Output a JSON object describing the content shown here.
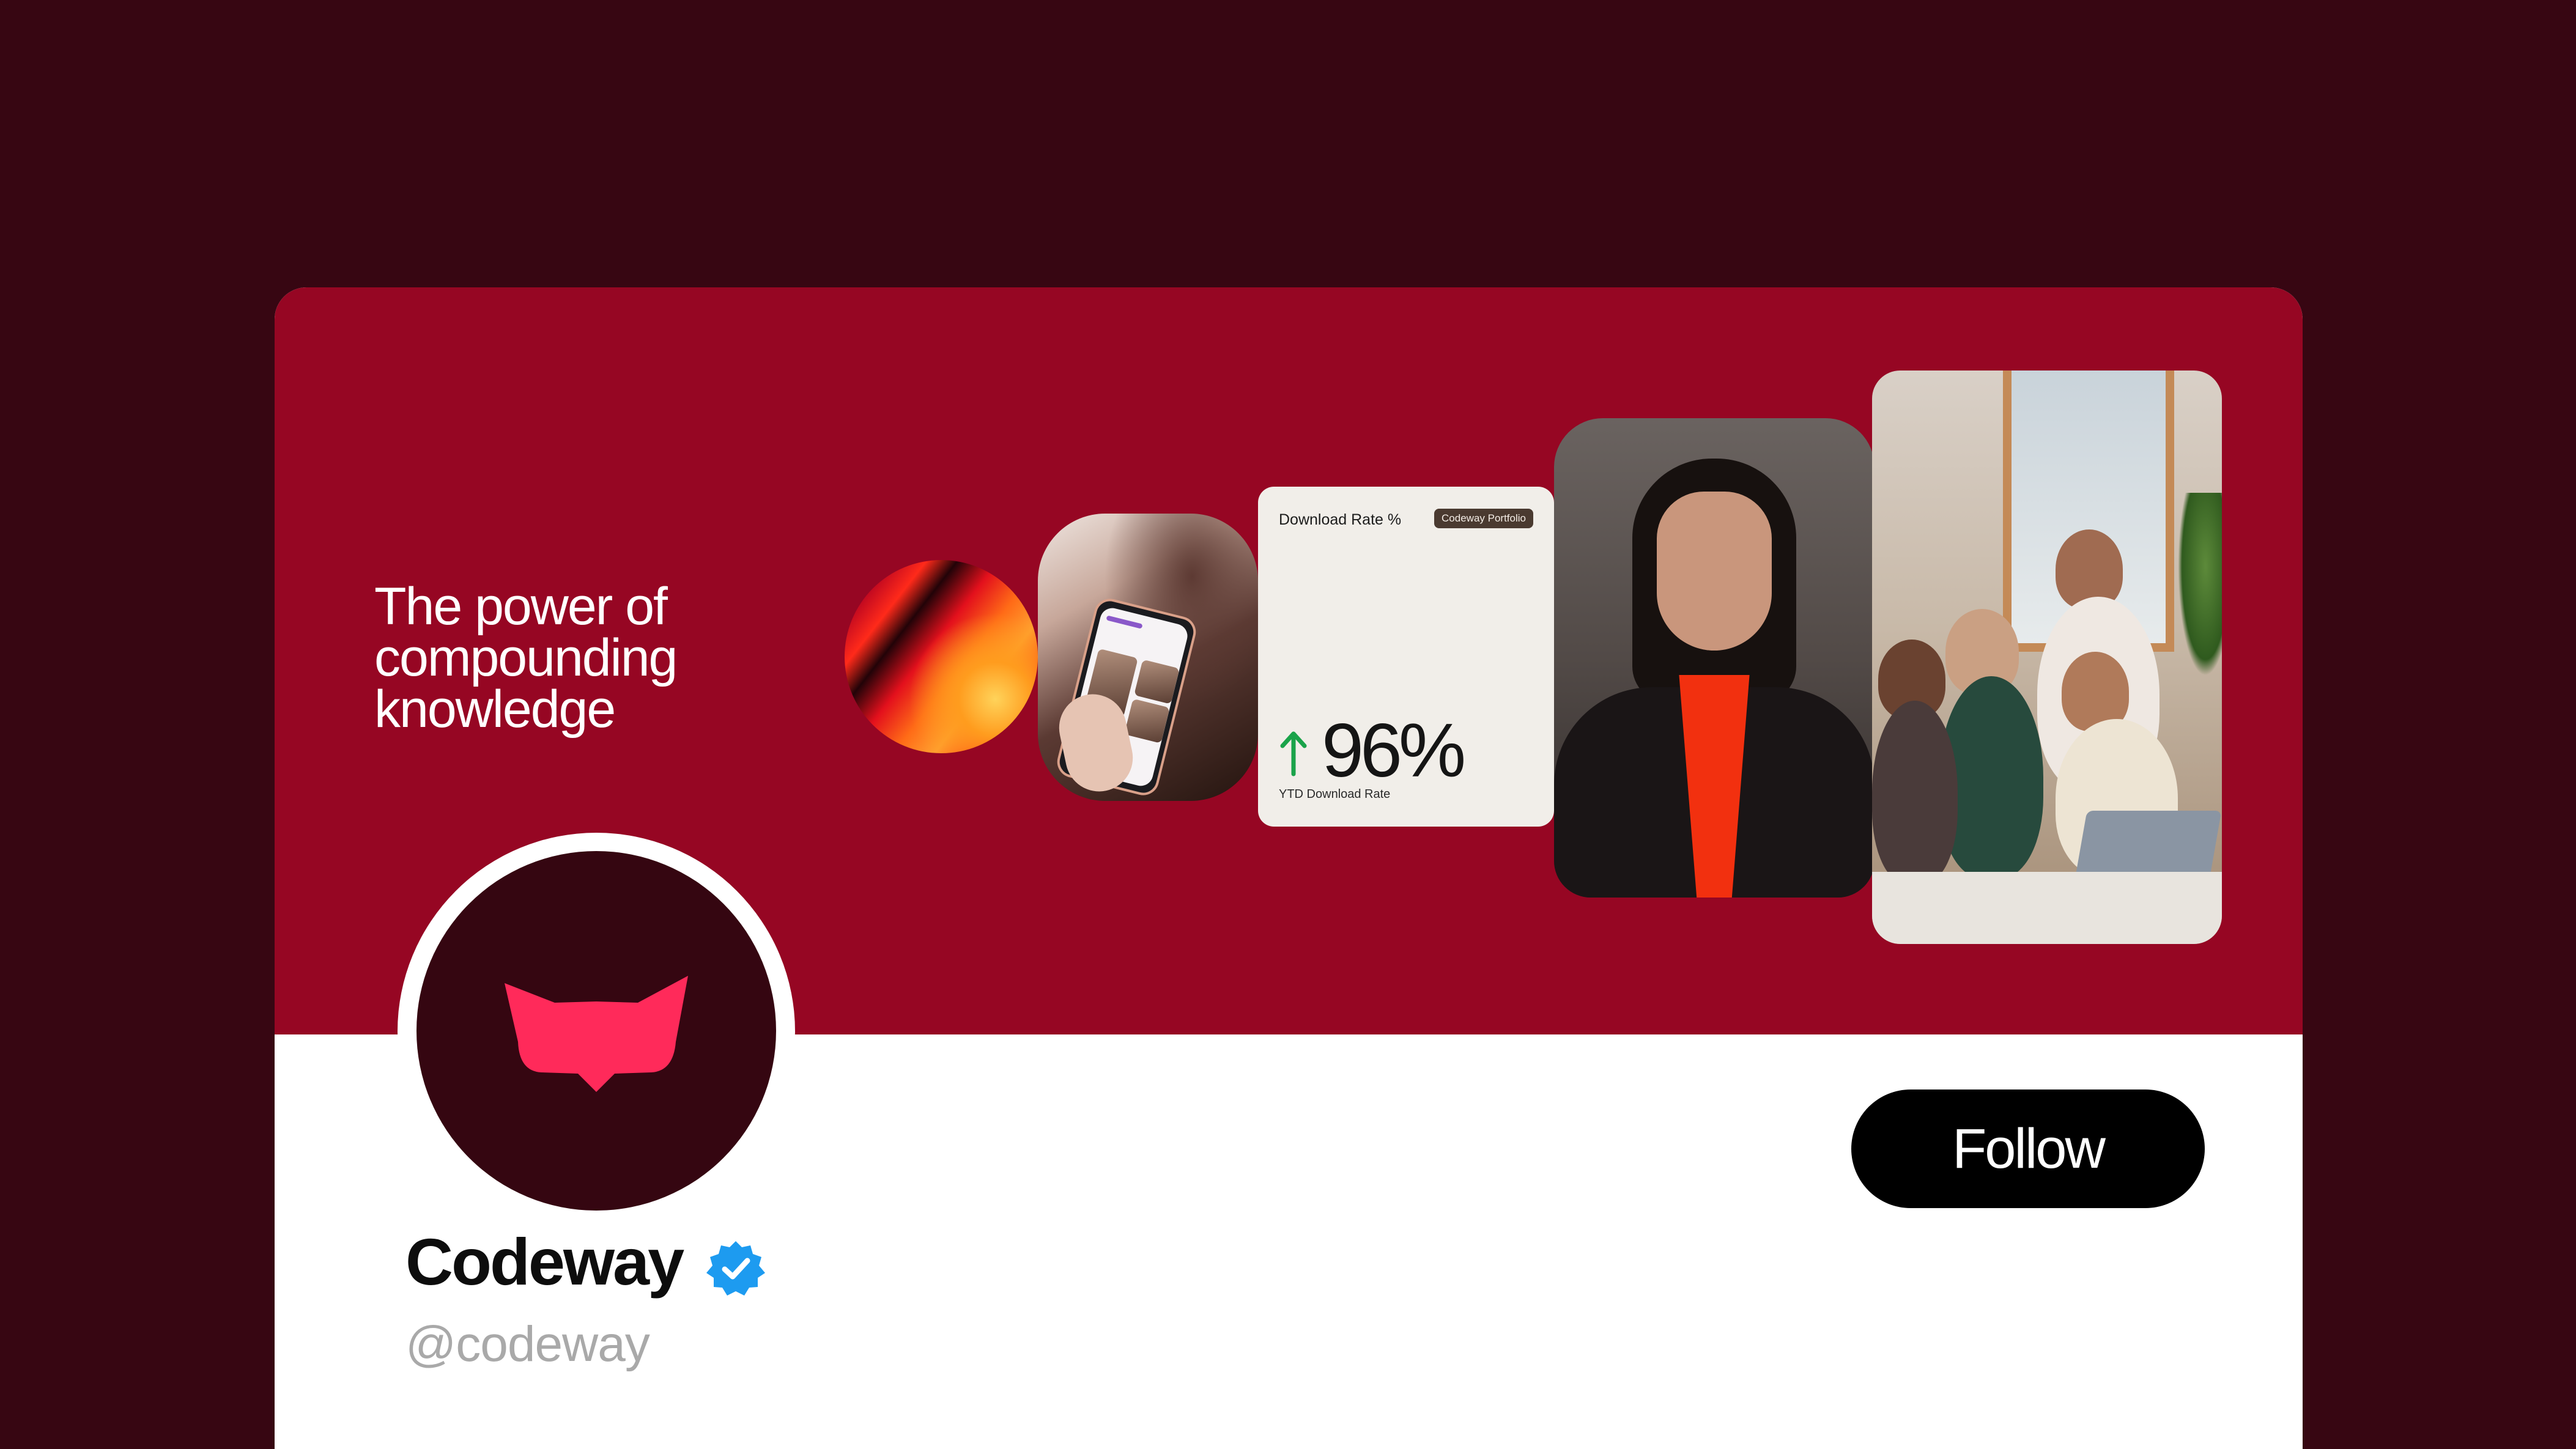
{
  "banner": {
    "tagline_lines": [
      "The power of",
      "compounding",
      "knowledge"
    ]
  },
  "stat_card": {
    "title": "Download Rate %",
    "badge": "Codeway Portfolio",
    "value": "96%",
    "subtitle": "YTD Download Rate"
  },
  "profile": {
    "name": "Codeway",
    "handle": "@codeway",
    "follow_label": "Follow"
  },
  "colors": {
    "page_background": "#370612",
    "banner": "#960623",
    "avatar": "#350611",
    "logo": "#ff2a5a",
    "verified": "#1d9bf0",
    "trend_up": "#1aa34a"
  },
  "icons": {
    "logo": "codeway-logo-icon",
    "verified": "verified-badge-icon",
    "trend": "arrow-up-icon"
  }
}
